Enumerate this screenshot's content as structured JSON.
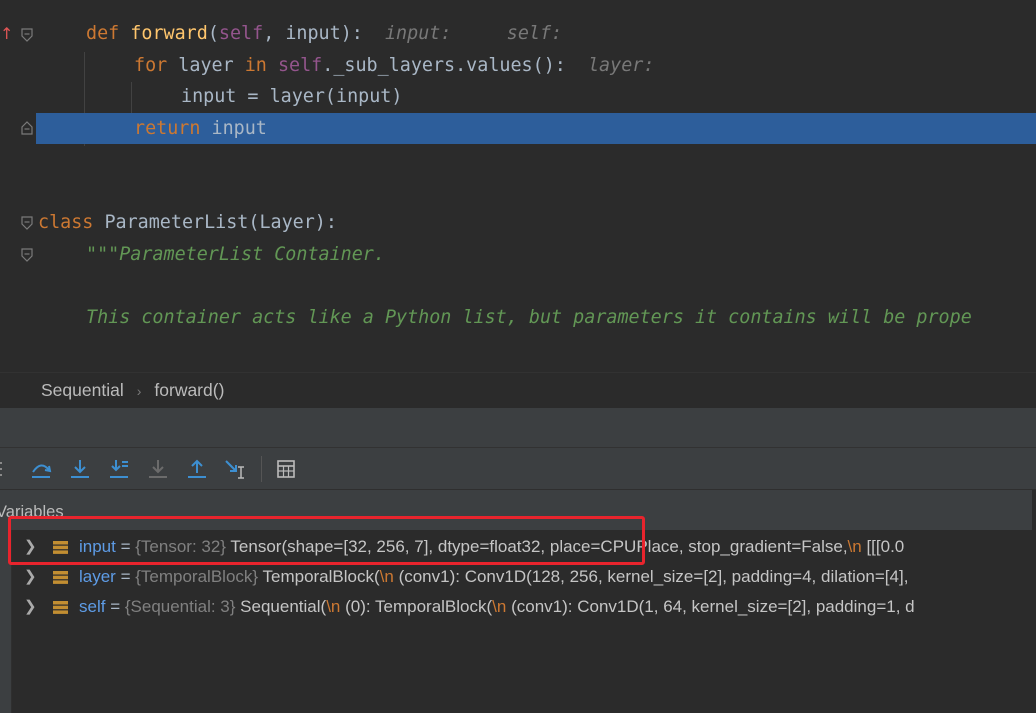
{
  "editor": {
    "lines": [
      [
        {
          "t": "def ",
          "c": "kw"
        },
        {
          "t": "forward",
          "c": "fn"
        },
        {
          "t": "(",
          "c": "txt"
        },
        {
          "t": "self",
          "c": "self"
        },
        {
          "t": ", input):  ",
          "c": "txt"
        },
        {
          "t": "input:     self:",
          "c": "hint"
        }
      ],
      [
        {
          "t": "for ",
          "c": "kw"
        },
        {
          "t": "layer ",
          "c": "txt"
        },
        {
          "t": "in ",
          "c": "kw"
        },
        {
          "t": "self",
          "c": "self"
        },
        {
          "t": "._sub_layers.values():  ",
          "c": "txt"
        },
        {
          "t": "layer:",
          "c": "hint"
        }
      ],
      [
        {
          "t": "input = layer(input)",
          "c": "txt"
        }
      ],
      [
        {
          "t": "return ",
          "c": "kw"
        },
        {
          "t": "input",
          "c": "txt"
        }
      ],
      [
        {
          "t": "class ",
          "c": "kw"
        },
        {
          "t": "ParameterList(Layer):",
          "c": "txt"
        }
      ],
      [
        {
          "t": "\"\"\"ParameterList Container.",
          "c": "doc"
        }
      ],
      [
        {
          "t": "This container acts like a Python list, but parameters it contains will be prope",
          "c": "doc"
        }
      ]
    ]
  },
  "breadcrumb": {
    "items": [
      "Sequential",
      "forward()"
    ],
    "separator": "›"
  },
  "toolbar": {
    "buttons": [
      "step-over-icon",
      "step-into-icon",
      "step-into-my-code-icon",
      "force-step-into-icon",
      "step-out-icon",
      "run-to-cursor-icon",
      "evaluate-expression-icon"
    ]
  },
  "variables": {
    "title": "Variables",
    "rows": [
      {
        "name": "input",
        "equals": " = ",
        "type": "{Tensor: 32}",
        "value_parts": [
          {
            "t": " Tensor(shape=[32, 256, 7], dtype=float32, place=CPUPlace, stop_gradient=False,",
            "c": "vval"
          },
          {
            "t": "\\n",
            "c": "vesc"
          },
          {
            "t": "       [[[0.0",
            "c": "vval"
          }
        ]
      },
      {
        "name": "layer",
        "equals": " = ",
        "type": "{TemporalBlock}",
        "value_parts": [
          {
            "t": " TemporalBlock(",
            "c": "vval"
          },
          {
            "t": "\\n",
            "c": "vesc"
          },
          {
            "t": "  (conv1): Conv1D(128, 256, kernel_size=[2], padding=4, dilation=[4], ",
            "c": "vval"
          }
        ]
      },
      {
        "name": "self",
        "equals": " = ",
        "type": "{Sequential: 3}",
        "value_parts": [
          {
            "t": " Sequential(",
            "c": "vval"
          },
          {
            "t": "\\n",
            "c": "vesc"
          },
          {
            "t": "  (0): TemporalBlock(",
            "c": "vval"
          },
          {
            "t": "\\n",
            "c": "vesc"
          },
          {
            "t": "    (conv1): Conv1D(1, 64, kernel_size=[2], padding=1, d",
            "c": "vval"
          }
        ]
      }
    ]
  },
  "colors": {
    "highlight_box": "#e8242d",
    "current_line": "#2d5e9b"
  }
}
